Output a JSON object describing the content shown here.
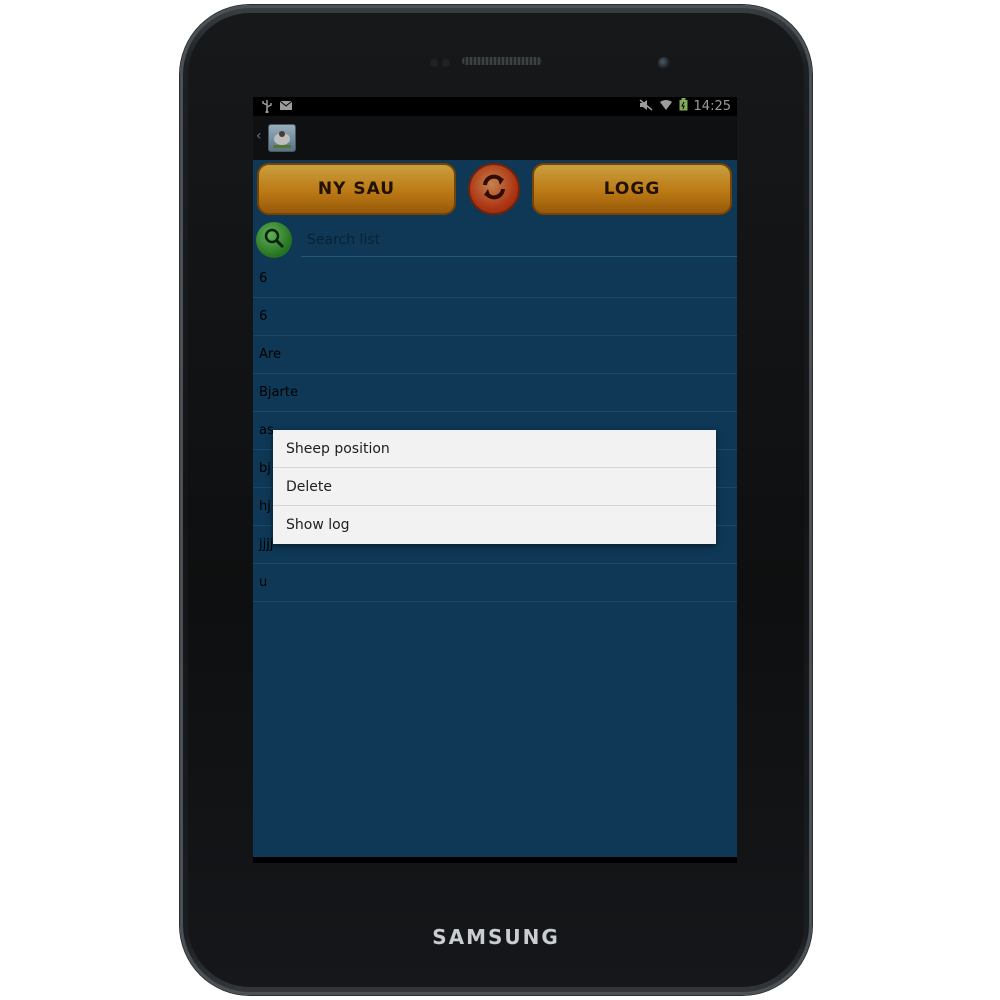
{
  "device": {
    "brand": "SAMSUNG"
  },
  "status_bar": {
    "time": "14:25"
  },
  "toolbar": {
    "new_sheep_label": "NY SAU",
    "log_label": "LOGG"
  },
  "search": {
    "placeholder": "Search list"
  },
  "sheep_list": [
    {
      "label": "6"
    },
    {
      "label": "6"
    },
    {
      "label": "Are"
    },
    {
      "label": "Bjarte"
    },
    {
      "label": "as"
    },
    {
      "label": "bj"
    },
    {
      "label": "hj"
    },
    {
      "label": "jjjj"
    },
    {
      "label": "u"
    }
  ],
  "context_menu": {
    "items": [
      {
        "label": "Sheep position"
      },
      {
        "label": "Delete"
      },
      {
        "label": "Show log"
      }
    ]
  },
  "icons": {
    "usb": "usb-icon",
    "mail": "mail-icon",
    "mute": "mute-icon",
    "wifi": "wifi-icon",
    "battery": "battery-icon",
    "refresh": "refresh-icon",
    "search": "search-icon",
    "recent_apps": "recent-apps-icon",
    "home": "home-icon",
    "back": "back-icon",
    "menu": "menu-up-icon"
  }
}
